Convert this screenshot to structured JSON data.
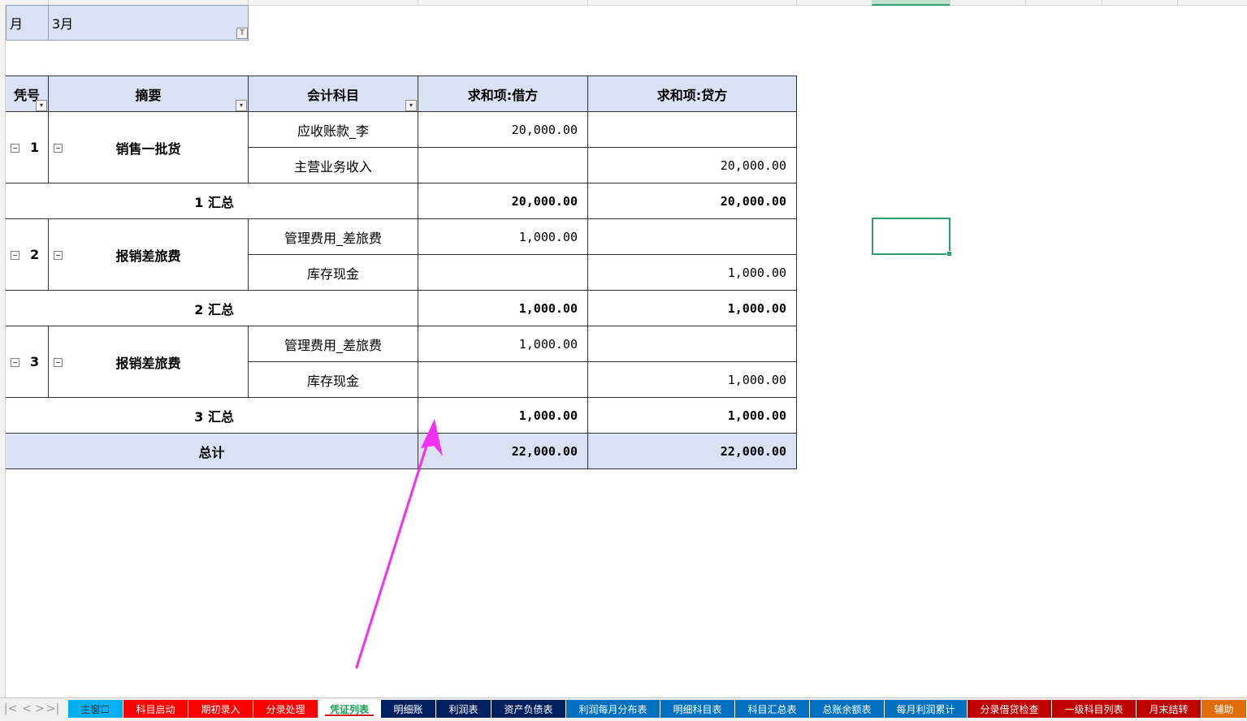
{
  "filter": {
    "label": "月",
    "value": "3月"
  },
  "pivot": {
    "headers": {
      "voucher": "凭号",
      "summary": "摘要",
      "account": "会计科目",
      "debit": "求和项:借方",
      "credit": "求和项:贷方"
    },
    "groups": [
      {
        "voucher": "1",
        "summary": "销售一批货",
        "rows": [
          {
            "account": "应收账款_李",
            "debit": "20,000.00",
            "credit": ""
          },
          {
            "account": "主营业务收入",
            "debit": "",
            "credit": "20,000.00"
          }
        ],
        "subtotal_label": "1 汇总",
        "subtotal_debit": "20,000.00",
        "subtotal_credit": "20,000.00"
      },
      {
        "voucher": "2",
        "summary": "报销差旅费",
        "rows": [
          {
            "account": "管理费用_差旅费",
            "debit": "1,000.00",
            "credit": ""
          },
          {
            "account": "库存现金",
            "debit": "",
            "credit": "1,000.00"
          }
        ],
        "subtotal_label": "2 汇总",
        "subtotal_debit": "1,000.00",
        "subtotal_credit": "1,000.00"
      },
      {
        "voucher": "3",
        "summary": "报销差旅费",
        "rows": [
          {
            "account": "管理费用_差旅费",
            "debit": "1,000.00",
            "credit": ""
          },
          {
            "account": "库存现金",
            "debit": "",
            "credit": "1,000.00"
          }
        ],
        "subtotal_label": "3 汇总",
        "subtotal_debit": "1,000.00",
        "subtotal_credit": "1,000.00"
      }
    ],
    "grand_total": {
      "label": "总计",
      "debit": "22,000.00",
      "credit": "22,000.00"
    }
  },
  "colors": {
    "header_fill": "#d9e1f2",
    "selection": "#2e9e6b",
    "arrow": "#f22ff2"
  },
  "sheet_tabs": [
    {
      "label": "主窗口",
      "color": "#00b0f0",
      "text_color": "#333333"
    },
    {
      "label": "科目启动",
      "color": "#ff0000",
      "text_color": "#ffffff"
    },
    {
      "label": "期初录入",
      "color": "#ff0000",
      "text_color": "#ffffff"
    },
    {
      "label": "分录处理",
      "color": "#ff0000",
      "text_color": "#ffffff"
    },
    {
      "label": "凭证列表",
      "color": "#ffffff",
      "text_color": "#1a9e52",
      "active": true
    },
    {
      "label": "明细账",
      "color": "#002060",
      "text_color": "#ffffff"
    },
    {
      "label": "利润表",
      "color": "#002060",
      "text_color": "#ffffff"
    },
    {
      "label": "资产负债表",
      "color": "#002060",
      "text_color": "#ffffff"
    },
    {
      "label": "利润每月分布表",
      "color": "#0070c0",
      "text_color": "#ffffff"
    },
    {
      "label": "明细科目表",
      "color": "#0070c0",
      "text_color": "#ffffff"
    },
    {
      "label": "科目汇总表",
      "color": "#0070c0",
      "text_color": "#ffffff"
    },
    {
      "label": "总账余额表",
      "color": "#0070c0",
      "text_color": "#ffffff"
    },
    {
      "label": "每月利润累计",
      "color": "#0070c0",
      "text_color": "#ffffff"
    },
    {
      "label": "分录借贷检查",
      "color": "#c00000",
      "text_color": "#ffffff"
    },
    {
      "label": "一级科目列表",
      "color": "#c00000",
      "text_color": "#ffffff"
    },
    {
      "label": "月末结转",
      "color": "#c00000",
      "text_color": "#ffffff"
    },
    {
      "label": "辅助",
      "color": "#e26b0a",
      "text_color": "#ffffff"
    }
  ],
  "tab_nav": {
    "first": "|<",
    "prev": "<",
    "next": ">",
    "last": ">|"
  }
}
